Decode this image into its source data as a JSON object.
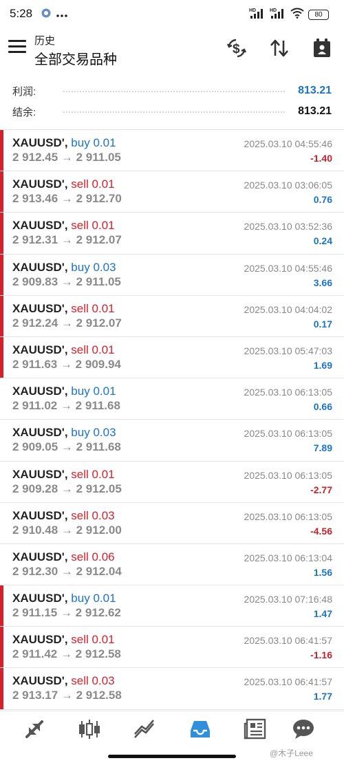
{
  "status_bar": {
    "time": "5:28",
    "battery": "80",
    "icons": [
      "app-notification-icon",
      "more-dots-icon",
      "hd-signal-icon",
      "hd-signal-icon",
      "wifi-icon",
      "battery-icon"
    ]
  },
  "header": {
    "subtitle": "历史",
    "title": "全部交易品种",
    "icons": [
      "currency-exchange-icon",
      "sort-arrows-icon",
      "calendar-icon"
    ]
  },
  "summary": {
    "profit_label": "利润:",
    "profit_value": "813.21",
    "balance_label": "结余:",
    "balance_value": "813.21"
  },
  "deals": [
    {
      "symbol": "XAUUSD',",
      "type": "buy",
      "volume": "0.01",
      "prices": "2 912.45 → 2 911.05",
      "time": "2025.03.10 04:55:46",
      "profit": "-1.40",
      "marked": true
    },
    {
      "symbol": "XAUUSD',",
      "type": "sell",
      "volume": "0.01",
      "prices": "2 913.46 → 2 912.70",
      "time": "2025.03.10 03:06:05",
      "profit": "0.76",
      "marked": true
    },
    {
      "symbol": "XAUUSD',",
      "type": "sell",
      "volume": "0.01",
      "prices": "2 912.31 → 2 912.07",
      "time": "2025.03.10 03:52:36",
      "profit": "0.24",
      "marked": true
    },
    {
      "symbol": "XAUUSD',",
      "type": "buy",
      "volume": "0.03",
      "prices": "2 909.83 → 2 911.05",
      "time": "2025.03.10 04:55:46",
      "profit": "3.66",
      "marked": true
    },
    {
      "symbol": "XAUUSD',",
      "type": "sell",
      "volume": "0.01",
      "prices": "2 912.24 → 2 912.07",
      "time": "2025.03.10 04:04:02",
      "profit": "0.17",
      "marked": true
    },
    {
      "symbol": "XAUUSD',",
      "type": "sell",
      "volume": "0.01",
      "prices": "2 911.63 → 2 909.94",
      "time": "2025.03.10 05:47:03",
      "profit": "1.69",
      "marked": true
    },
    {
      "symbol": "XAUUSD',",
      "type": "buy",
      "volume": "0.01",
      "prices": "2 911.02 → 2 911.68",
      "time": "2025.03.10 06:13:05",
      "profit": "0.66",
      "marked": false
    },
    {
      "symbol": "XAUUSD',",
      "type": "buy",
      "volume": "0.03",
      "prices": "2 909.05 → 2 911.68",
      "time": "2025.03.10 06:13:05",
      "profit": "7.89",
      "marked": false
    },
    {
      "symbol": "XAUUSD',",
      "type": "sell",
      "volume": "0.01",
      "prices": "2 909.28 → 2 912.05",
      "time": "2025.03.10 06:13:05",
      "profit": "-2.77",
      "marked": false
    },
    {
      "symbol": "XAUUSD',",
      "type": "sell",
      "volume": "0.03",
      "prices": "2 910.48 → 2 912.00",
      "time": "2025.03.10 06:13:05",
      "profit": "-4.56",
      "marked": false
    },
    {
      "symbol": "XAUUSD',",
      "type": "sell",
      "volume": "0.06",
      "prices": "2 912.30 → 2 912.04",
      "time": "2025.03.10 06:13:04",
      "profit": "1.56",
      "marked": false
    },
    {
      "symbol": "XAUUSD',",
      "type": "buy",
      "volume": "0.01",
      "prices": "2 911.15 → 2 912.62",
      "time": "2025.03.10 07:16:48",
      "profit": "1.47",
      "marked": true
    },
    {
      "symbol": "XAUUSD',",
      "type": "sell",
      "volume": "0.01",
      "prices": "2 911.42 → 2 912.58",
      "time": "2025.03.10 06:41:57",
      "profit": "-1.16",
      "marked": true
    },
    {
      "symbol": "XAUUSD',",
      "type": "sell",
      "volume": "0.03",
      "prices": "2 913.17 → 2 912.58",
      "time": "2025.03.10 06:41:57",
      "profit": "1.77",
      "marked": true
    }
  ],
  "bottom_nav": [
    {
      "name": "nav-quotes",
      "icon": "quotes-arrows-icon",
      "active": false
    },
    {
      "name": "nav-chart",
      "icon": "candlestick-icon",
      "active": false
    },
    {
      "name": "nav-trade",
      "icon": "trend-line-icon",
      "active": false
    },
    {
      "name": "nav-history",
      "icon": "inbox-icon",
      "active": true
    },
    {
      "name": "nav-news",
      "icon": "newspaper-icon",
      "active": false
    },
    {
      "name": "nav-messages",
      "icon": "chat-bubble-icon",
      "active": false
    }
  ],
  "watermark": "@木子Leee",
  "colors": {
    "buy": "#1a73c9",
    "sell": "#d8202b",
    "profit_positive": "#1a73c9",
    "profit_negative": "#c4212a",
    "active_nav": "#2f8fdd",
    "inactive_nav": "#555555"
  }
}
